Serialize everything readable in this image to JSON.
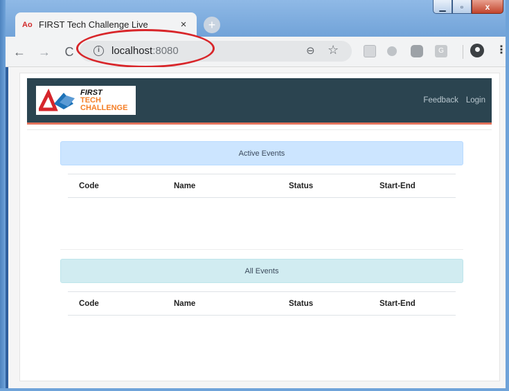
{
  "browser": {
    "tab_title": "FIRST Tech Challenge Live",
    "tab_close": "×",
    "new_tab": "+",
    "url_host": "localhost",
    "url_port": ":8080",
    "info_glyph": "i",
    "back_glyph": "←",
    "forward_glyph": "→",
    "reload_glyph": "C",
    "zoom_glyph": "⊖",
    "star_glyph": "☆",
    "menu_glyph": "⋮",
    "min_glyph": "▁",
    "max_glyph": "▫",
    "close_glyph": "x",
    "extensions": [
      "pdf-extension-icon",
      "circle-extension-icon",
      "cloud-extension-icon",
      "g-extension-icon"
    ],
    "g_extension_label": "G"
  },
  "header": {
    "logo_first": "FIRST",
    "logo_tech": "TECH",
    "logo_challenge": "CHALLENGE",
    "nav": [
      "Feedback",
      "Login"
    ]
  },
  "sections": {
    "active": {
      "title": "Active Events",
      "columns": [
        "Code",
        "Name",
        "Status",
        "Start-End"
      ],
      "rows": []
    },
    "all": {
      "title": "All Events",
      "columns": [
        "Code",
        "Name",
        "Status",
        "Start-End"
      ],
      "rows": []
    }
  },
  "colors": {
    "navbar": "#2b4450",
    "accent_stripe": "#e2725b",
    "active_header_bg": "#cce5ff",
    "all_header_bg": "#d1ecf1",
    "highlight_ring": "#d8262a"
  }
}
